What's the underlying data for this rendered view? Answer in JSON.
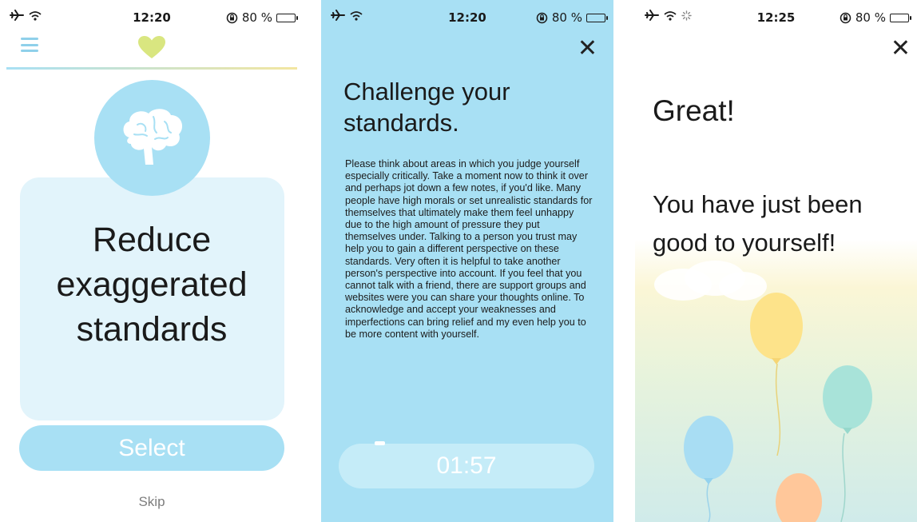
{
  "status_bars": [
    {
      "time": "12:20",
      "battery": "80 %"
    },
    {
      "time": "12:20",
      "battery": "80 %"
    },
    {
      "time": "12:25",
      "battery": "80 %"
    }
  ],
  "icons": {
    "airplane": "airplane-icon",
    "wifi": "wifi-icon",
    "rotation_lock": "rotation-lock-icon",
    "battery": "battery-icon",
    "menu": "hamburger-menu-icon",
    "heart": "heart-icon",
    "brain": "brain-icon",
    "close": "close-icon",
    "loading": "loading-spinner-icon"
  },
  "battery_level": 0.8,
  "colors": {
    "primary_blue": "#a8e0f4",
    "card_blue": "#e2f4fb",
    "heart_green": "#d9e680",
    "balloon_yellow": "#fde38a",
    "balloon_teal": "#a8e3d9",
    "balloon_blue": "#a8ddf3",
    "balloon_orange": "#ffc79a"
  },
  "screen1": {
    "card_title": "Reduce\nexaggerated\nstandards",
    "select_label": "Select",
    "skip_label": "Skip"
  },
  "screen2": {
    "close_glyph": "✕",
    "title": "Challenge your standards.",
    "body": "Please think about areas in which you judge yourself especially critically. Take a moment now to think it over and perhaps jot down a few notes, if you'd like. Many people have high morals or set unrealistic standards for themselves that ultimately make them feel unhappy due to the high amount of pressure they put themselves under. Talking to a person you trust may help you to gain a different perspective on these standards. Very often it is helpful to take another person's perspective into account. If you feel that you cannot talk with a friend, there are support groups and websites were you can share your thoughts online. To acknowledge and accept your weaknesses and imperfections can bring relief and my even help you to be more content with yourself.",
    "timer": "01:57"
  },
  "screen3": {
    "close_glyph": "✕",
    "heading": "Great!",
    "message": "You have just been good to yourself!"
  }
}
